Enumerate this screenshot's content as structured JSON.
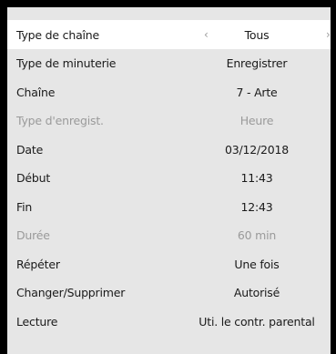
{
  "rows": [
    {
      "label": "Type de chaîne",
      "value": "Tous",
      "selected": true,
      "disabled": false,
      "arrows": true
    },
    {
      "label": "Type de minuterie",
      "value": "Enregistrer",
      "selected": false,
      "disabled": false
    },
    {
      "label": "Chaîne",
      "value": "7 - Arte",
      "selected": false,
      "disabled": false
    },
    {
      "label": "Type d'enregist.",
      "value": "Heure",
      "selected": false,
      "disabled": true
    },
    {
      "label": "Date",
      "value": "03/12/2018",
      "selected": false,
      "disabled": false
    },
    {
      "label": "Début",
      "value": "11:43",
      "selected": false,
      "disabled": false
    },
    {
      "label": "Fin",
      "value": "12:43",
      "selected": false,
      "disabled": false
    },
    {
      "label": "Durée",
      "value": "60 min",
      "selected": false,
      "disabled": true
    },
    {
      "label": "Répéter",
      "value": "Une fois",
      "selected": false,
      "disabled": false
    },
    {
      "label": "Changer/Supprimer",
      "value": "Autorisé",
      "selected": false,
      "disabled": false
    },
    {
      "label": "Lecture",
      "value": "Uti. le contr. parental",
      "selected": false,
      "disabled": false
    }
  ],
  "icons": {
    "left": "chevron-left-icon",
    "right": "chevron-right-icon"
  },
  "colors": {
    "background": "#e6e6e6",
    "selected_row": "#ffffff",
    "text": "#1a1a1a",
    "disabled_text": "#9a9a9a"
  }
}
